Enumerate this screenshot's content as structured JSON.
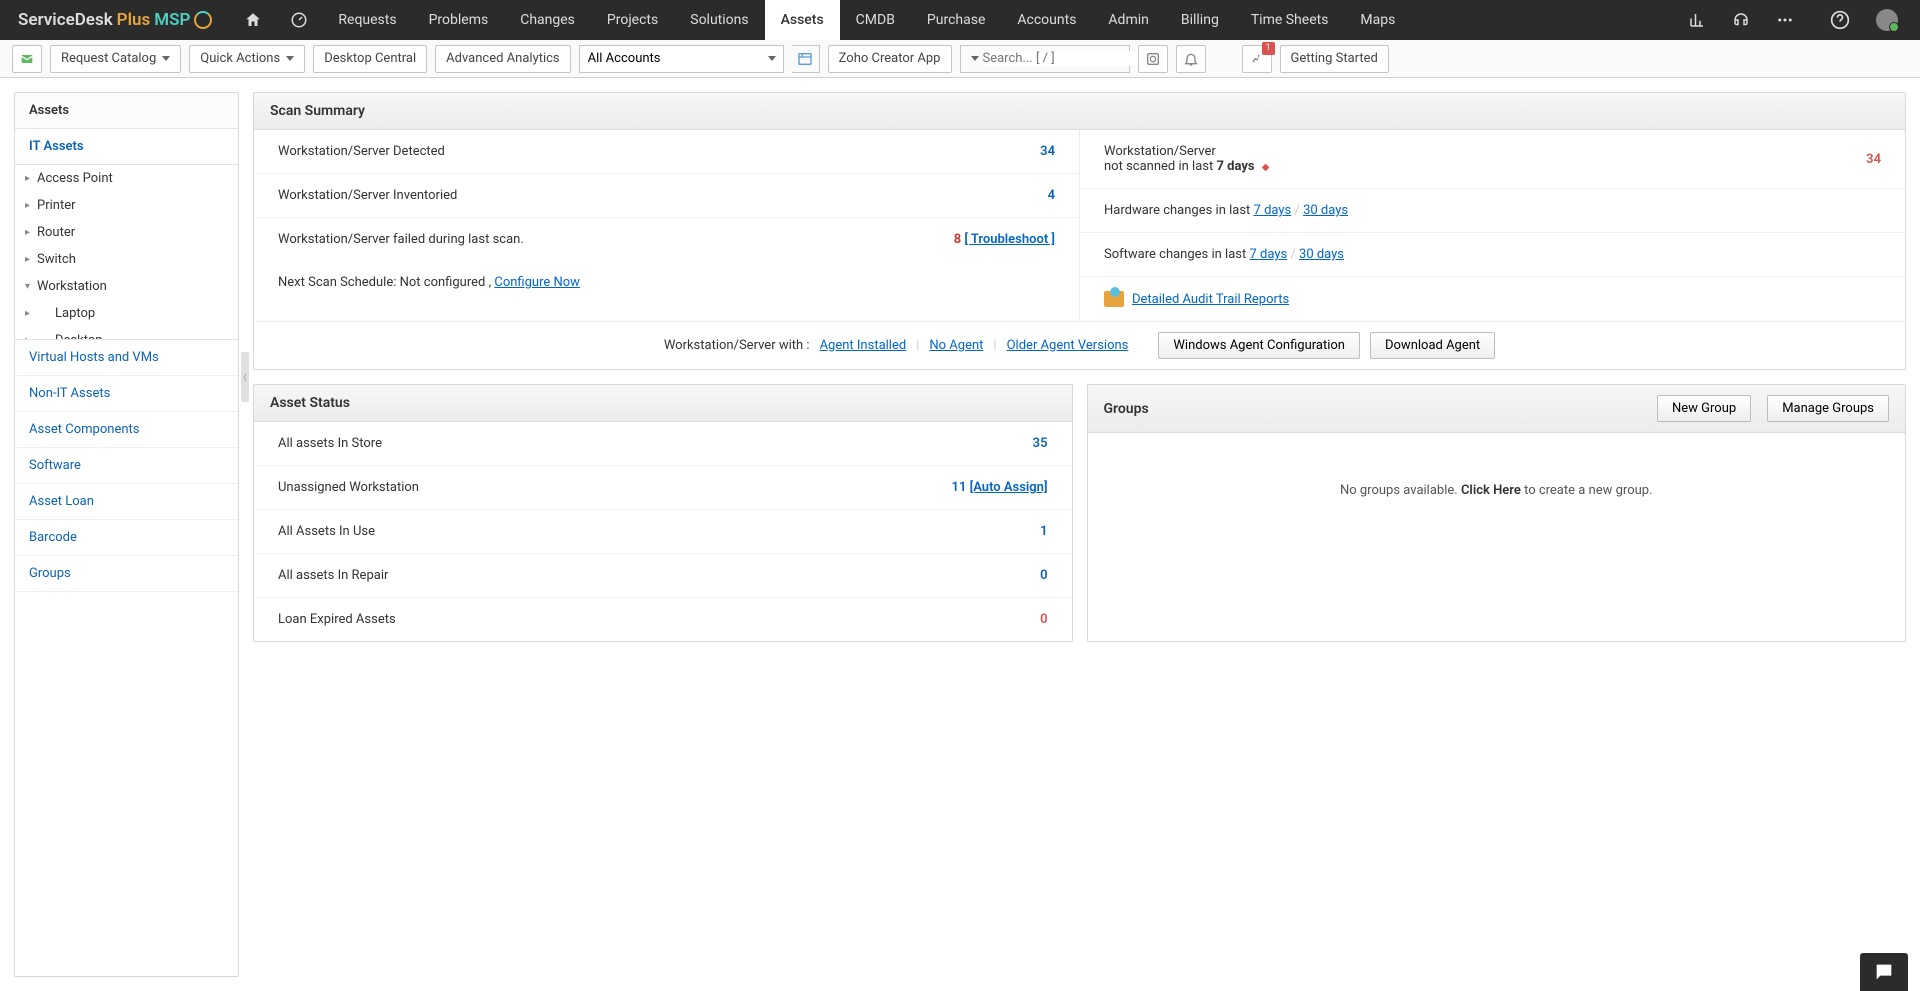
{
  "brand": {
    "text_a": "ServiceDesk ",
    "text_b": "Plus ",
    "text_c": "MSP"
  },
  "topnav": {
    "items": [
      "Requests",
      "Problems",
      "Changes",
      "Projects",
      "Solutions",
      "Assets",
      "CMDB",
      "Purchase",
      "Accounts",
      "Admin",
      "Billing",
      "Time Sheets",
      "Maps"
    ],
    "active": "Assets"
  },
  "toolbar": {
    "request_catalog": "Request Catalog",
    "quick_actions": "Quick Actions",
    "desktop_central": "Desktop Central",
    "advanced_analytics": "Advanced Analytics",
    "account_select": "All Accounts",
    "zoho_creator": "Zoho Creator App",
    "search_placeholder": "Search... [ / ]",
    "getting_started": "Getting Started",
    "pin_badge": "1"
  },
  "sidebar": {
    "title": "Assets",
    "it_assets": "IT Assets",
    "tree": [
      {
        "label": "Access Point",
        "sub": false
      },
      {
        "label": "Printer",
        "sub": false
      },
      {
        "label": "Router",
        "sub": false
      },
      {
        "label": "Switch",
        "sub": false
      },
      {
        "label": "Workstation",
        "sub": false,
        "expanded": true
      },
      {
        "label": "Laptop",
        "sub": true
      },
      {
        "label": "Desktop",
        "sub": true
      }
    ],
    "links": [
      "Virtual Hosts and VMs",
      "Non-IT Assets",
      "Asset Components",
      "Software",
      "Asset Loan",
      "Barcode",
      "Groups"
    ]
  },
  "scan_summary": {
    "title": "Scan Summary",
    "left": [
      {
        "label": "Workstation/Server Detected",
        "value": "34",
        "style": "link"
      },
      {
        "label": "Workstation/Server Inventoried",
        "value": "4",
        "style": "link"
      },
      {
        "label": "Workstation/Server failed during last scan.",
        "value": "8",
        "suffix": "[ Troubleshoot ]",
        "style": "fail"
      }
    ],
    "next_scan_prefix": "Next Scan Schedule: Not configured , ",
    "next_scan_link": "Configure Now",
    "right": {
      "notscanned_l1": "Workstation/Server",
      "notscanned_l2a": "not scanned in last ",
      "notscanned_l2b": "7 days",
      "notscanned_val": "34",
      "hw_label": "Hardware changes in last ",
      "sw_label": "Software changes in last ",
      "d7": "7 days",
      "d30": "30 days",
      "audit_link": "Detailed Audit Trail Reports"
    },
    "agent_bar": {
      "prefix": "Workstation/Server with : ",
      "links": [
        "Agent Installed",
        "No Agent",
        "Older Agent Versions"
      ],
      "btn1": "Windows Agent Configuration",
      "btn2": "Download Agent"
    }
  },
  "asset_status": {
    "title": "Asset Status",
    "rows": [
      {
        "label": "All assets In Store",
        "value": "35",
        "style": "link"
      },
      {
        "label": "Unassigned Workstation",
        "value": "11",
        "suffix": "[Auto Assign]",
        "style": "link"
      },
      {
        "label": "All Assets In Use",
        "value": "1",
        "style": "link"
      },
      {
        "label": "All assets In Repair",
        "value": "0",
        "style": "link"
      },
      {
        "label": "Loan Expired Assets",
        "value": "0",
        "style": "red"
      }
    ]
  },
  "groups": {
    "title": "Groups",
    "btn_new": "New Group",
    "btn_manage": "Manage Groups",
    "empty_a": "No groups available. ",
    "empty_b": "Click Here",
    "empty_c": " to create a new group."
  }
}
